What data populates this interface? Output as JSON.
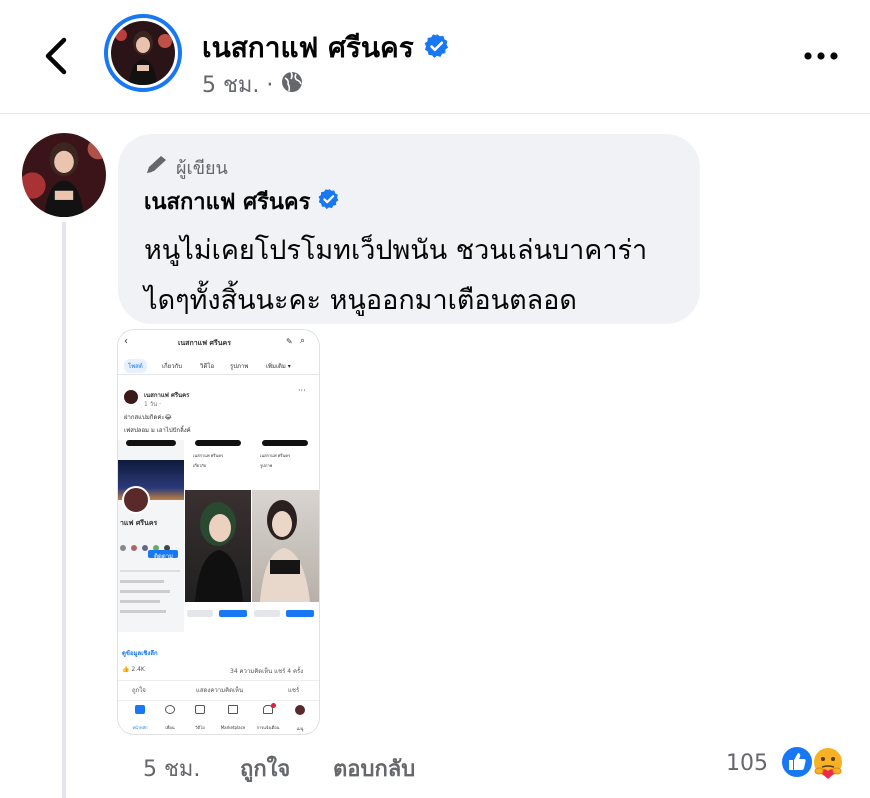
{
  "header": {
    "name": "เนสกาแฟ ศรีนคร",
    "time": "5 ชม. ·"
  },
  "comment": {
    "author_tag": "ผู้เขียน",
    "name": "เนสกาแฟ ศรีนคร",
    "text_line1": "หนูไม่เคยโปรโมทเว็ปพนัน ชวนเล่นบาคาร่า",
    "text_line2": "ไดๆทั้งสิ้นนะคะ หนูออกมาเตือนตลอด",
    "time": "5 ชม.",
    "like_label": "ถูกใจ",
    "reply_label": "ตอบกลับ",
    "reaction_count": "105"
  },
  "screenshot": {
    "page_title": "เนสกาแฟ ศรีนคร",
    "tabs": [
      "โพสต์",
      "เกี่ยวกับ",
      "วิดีโอ",
      "รูปภาพ",
      "เพิ่มเติม ▾"
    ],
    "post_name": "เนสกาแฟ ศรีนคร",
    "post_sub": "1 วัน · ",
    "post_text1": "ฝากสแปมกิดค่ะ😂",
    "post_text2": "เฟสปลอม ม เอาไปปักลิ้งค์",
    "panel_name": "เนสกาแฟ ศรีนคร",
    "panel_sub1": "เกี่ยวกับ",
    "panel_sub2": "รูปภาพ",
    "left_name": "าแฟ ศรีนคร",
    "follow_label": "ติดตาม",
    "more_info": "ดูข้อมูลเชิงลึก",
    "likes": "2.4K",
    "stats": "34 ความคิดเห็น  แชร์ 4 ครั้ง",
    "like_btn": "ถูกใจ",
    "comment_btn": "แสดงความคิดเห็น",
    "share_btn": "แชร์",
    "nav": [
      "หน้าหลัก",
      "เพื่อน",
      "วิดีโอ",
      "Marketplace",
      "การแจ้งเตือน",
      "เมนู"
    ]
  },
  "colors": {
    "accent": "#1877f2",
    "secondary_text": "#65676b",
    "bubble": "#f0f2f5"
  },
  "icons": [
    "back-arrow-icon",
    "verified-badge-icon",
    "globe-icon",
    "more-dots-icon",
    "pencil-icon",
    "like-reaction-icon",
    "care-reaction-icon"
  ]
}
